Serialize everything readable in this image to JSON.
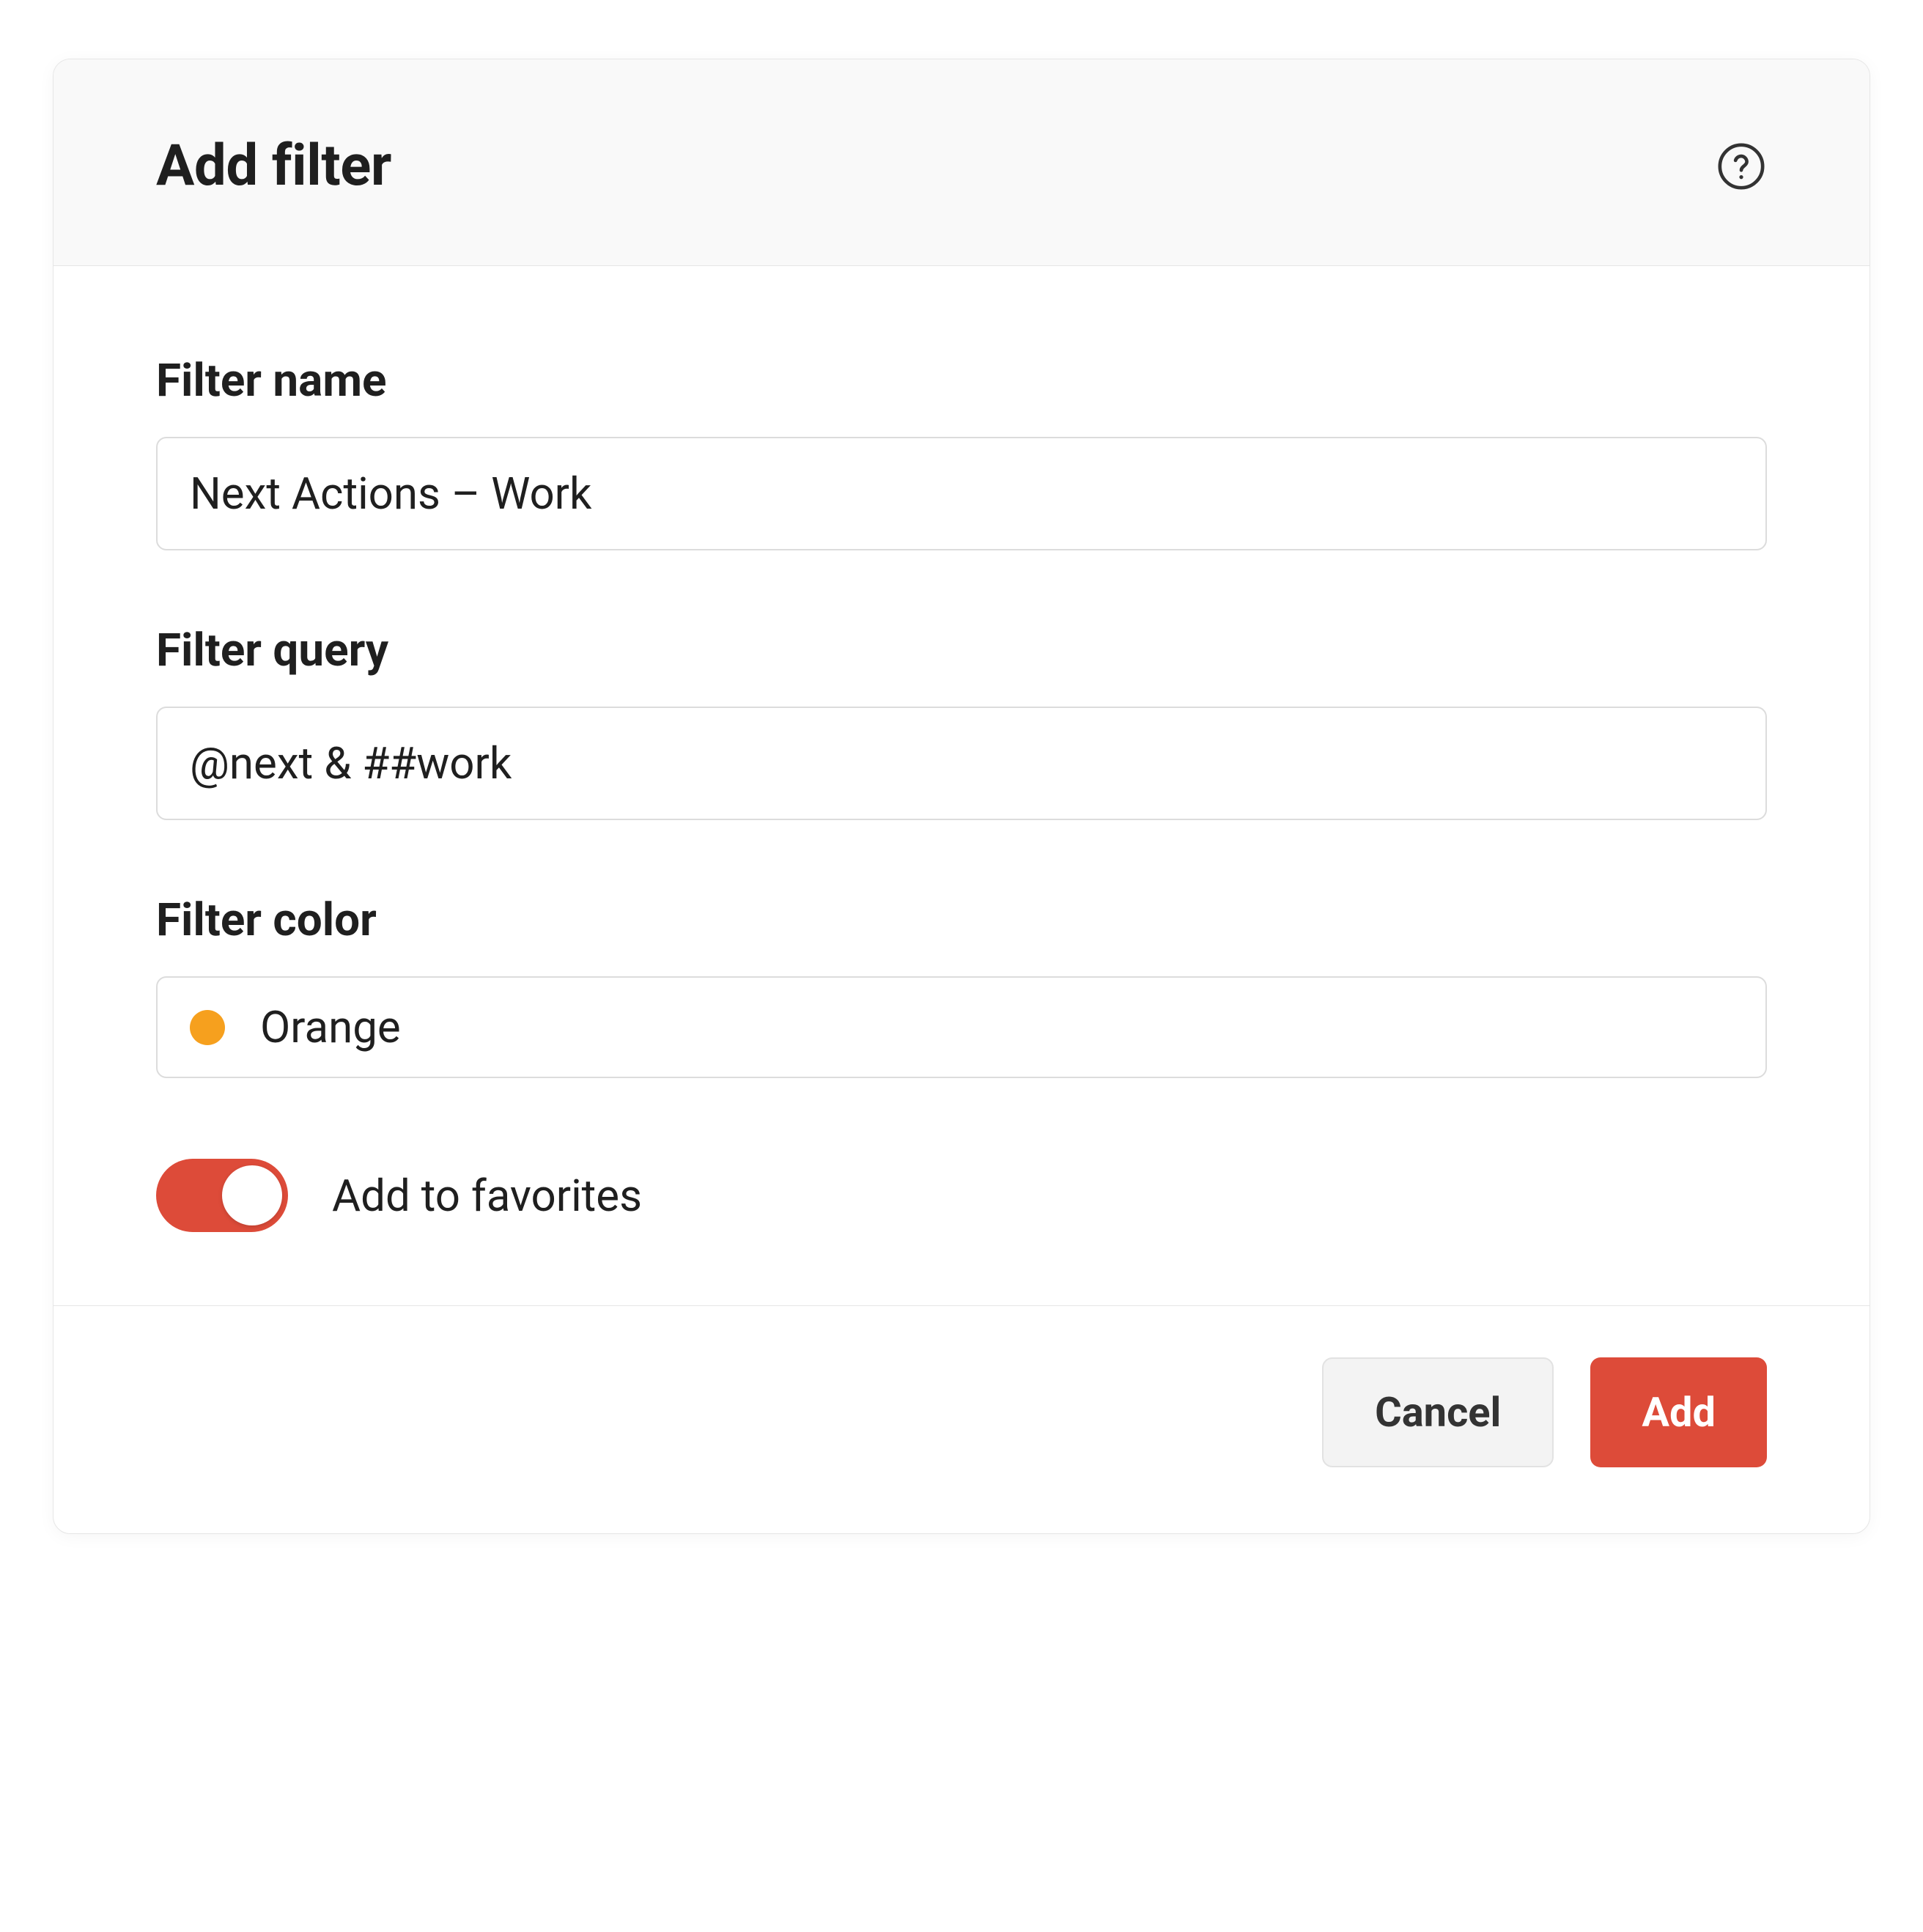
{
  "dialog": {
    "title": "Add filter"
  },
  "form": {
    "filter_name": {
      "label": "Filter name",
      "value": "Next Actions – Work"
    },
    "filter_query": {
      "label": "Filter query",
      "value": "@next & ##work"
    },
    "filter_color": {
      "label": "Filter color",
      "selected_name": "Orange",
      "selected_hex": "#f6a01e"
    },
    "favorites": {
      "label": "Add to favorites",
      "on": true,
      "accent": "#dd4b39"
    }
  },
  "footer": {
    "cancel_label": "Cancel",
    "submit_label": "Add"
  },
  "icons": {
    "help": "help-icon"
  }
}
